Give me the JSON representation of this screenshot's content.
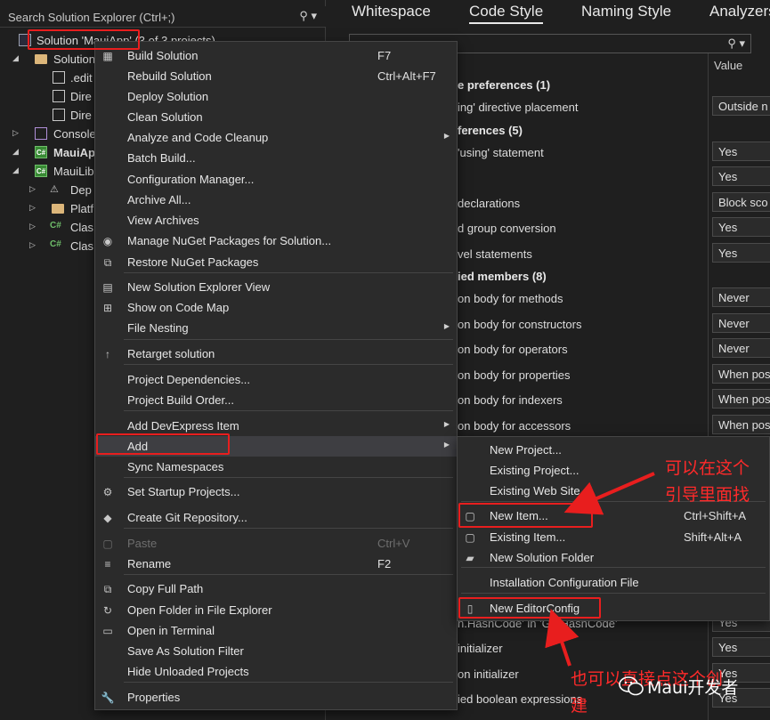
{
  "solution_explorer": {
    "search_placeholder": "Search Solution Explorer (Ctrl+;)",
    "tree": [
      {
        "label": "Solution 'MauiApp' (3 of 3 projects)",
        "icon": "solution-icon",
        "bold": false
      },
      {
        "label": "Solution",
        "icon": "folder-icon",
        "bold": false
      },
      {
        "label": ".edit",
        "icon": "file-icon",
        "bold": false
      },
      {
        "label": "Dire",
        "icon": "file-icon",
        "bold": false
      },
      {
        "label": "Dire",
        "icon": "file-icon",
        "bold": false
      },
      {
        "label": "Console",
        "icon": "console-project-icon",
        "bold": false
      },
      {
        "label": "MauiAp",
        "icon": "csharp-project-icon",
        "bold": true
      },
      {
        "label": "MauiLib",
        "icon": "csharp-project-icon",
        "bold": false
      },
      {
        "label": "Dep",
        "icon": "dependencies-icon",
        "bold": false
      },
      {
        "label": "Platf",
        "icon": "folder-icon",
        "bold": false
      },
      {
        "label": "Clas",
        "icon": "csharp-file-icon",
        "bold": false
      },
      {
        "label": "Clas",
        "icon": "csharp-file-icon",
        "bold": false
      }
    ]
  },
  "editor": {
    "tabs": [
      "Whitespace",
      "Code Style",
      "Naming Style",
      "Analyzers"
    ],
    "active_tab": "Code Style",
    "value_header": "Value",
    "rows": [
      {
        "label": "e preferences (1)",
        "section": true,
        "value": ""
      },
      {
        "label": "ing' directive placement",
        "section": false,
        "value": "Outside n"
      },
      {
        "label": "ferences (5)",
        "section": true,
        "value": ""
      },
      {
        "label": "'using' statement",
        "section": false,
        "value": "Yes"
      },
      {
        "label": "",
        "section": false,
        "value": "Yes"
      },
      {
        "label": "declarations",
        "section": false,
        "value": "Block sco"
      },
      {
        "label": "d group conversion",
        "section": false,
        "value": "Yes"
      },
      {
        "label": "vel statements",
        "section": false,
        "value": "Yes"
      },
      {
        "label": "ied members (8)",
        "section": true,
        "value": ""
      },
      {
        "label": "on body for methods",
        "section": false,
        "value": "Never"
      },
      {
        "label": "on body for constructors",
        "section": false,
        "value": "Never"
      },
      {
        "label": "on body for operators",
        "section": false,
        "value": "Never"
      },
      {
        "label": "on body for properties",
        "section": false,
        "value": "When pos"
      },
      {
        "label": "on body for indexers",
        "section": false,
        "value": "When pos"
      },
      {
        "label": "on body for accessors",
        "section": false,
        "value": "When pos"
      },
      {
        "label": "n.HashCode' in 'GetHashCode'",
        "section": false,
        "value": "Yes"
      },
      {
        "label": "initializer",
        "section": false,
        "value": "Yes"
      },
      {
        "label": "on initializer",
        "section": false,
        "value": "Yes"
      },
      {
        "label": "ied boolean expressions",
        "section": false,
        "value": "Yes"
      }
    ]
  },
  "context_menu": {
    "items": [
      {
        "label": "Build Solution",
        "shortcut": "F7",
        "icon": "build-icon",
        "submenu": false,
        "disabled": false
      },
      {
        "label": "Rebuild Solution",
        "shortcut": "Ctrl+Alt+F7",
        "icon": "",
        "submenu": false,
        "disabled": false
      },
      {
        "label": "Deploy Solution",
        "shortcut": "",
        "icon": "",
        "submenu": false,
        "disabled": false
      },
      {
        "label": "Clean Solution",
        "shortcut": "",
        "icon": "",
        "submenu": false,
        "disabled": false
      },
      {
        "label": "Analyze and Code Cleanup",
        "shortcut": "",
        "icon": "",
        "submenu": true,
        "disabled": false
      },
      {
        "label": "Batch Build...",
        "shortcut": "",
        "icon": "",
        "submenu": false,
        "disabled": false
      },
      {
        "label": "Configuration Manager...",
        "shortcut": "",
        "icon": "",
        "submenu": false,
        "disabled": false
      },
      {
        "label": "Archive All...",
        "shortcut": "",
        "icon": "",
        "submenu": false,
        "disabled": false
      },
      {
        "label": "View Archives",
        "shortcut": "",
        "icon": "",
        "submenu": false,
        "disabled": false
      },
      {
        "label": "Manage NuGet Packages for Solution...",
        "shortcut": "",
        "icon": "nuget-icon",
        "submenu": false,
        "disabled": false
      },
      {
        "label": "Restore NuGet Packages",
        "shortcut": "",
        "icon": "restore-icon",
        "submenu": false,
        "disabled": false
      },
      {
        "label": "New Solution Explorer View",
        "shortcut": "",
        "icon": "new-view-icon",
        "submenu": false,
        "disabled": false
      },
      {
        "label": "Show on Code Map",
        "shortcut": "",
        "icon": "code-map-icon",
        "submenu": false,
        "disabled": false
      },
      {
        "label": "File Nesting",
        "shortcut": "",
        "icon": "",
        "submenu": true,
        "disabled": false
      },
      {
        "label": "Retarget solution",
        "shortcut": "",
        "icon": "retarget-icon",
        "submenu": false,
        "disabled": false
      },
      {
        "label": "Project Dependencies...",
        "shortcut": "",
        "icon": "",
        "submenu": false,
        "disabled": false
      },
      {
        "label": "Project Build Order...",
        "shortcut": "",
        "icon": "",
        "submenu": false,
        "disabled": false
      },
      {
        "label": "Add DevExpress Item",
        "shortcut": "",
        "icon": "",
        "submenu": true,
        "disabled": false
      },
      {
        "label": "Add",
        "shortcut": "",
        "icon": "",
        "submenu": true,
        "disabled": false
      },
      {
        "label": "Sync Namespaces",
        "shortcut": "",
        "icon": "",
        "submenu": false,
        "disabled": false
      },
      {
        "label": "Set Startup Projects...",
        "shortcut": "",
        "icon": "gear-icon",
        "submenu": false,
        "disabled": false
      },
      {
        "label": "Create Git Repository...",
        "shortcut": "",
        "icon": "git-icon",
        "submenu": false,
        "disabled": false
      },
      {
        "label": "Paste",
        "shortcut": "Ctrl+V",
        "icon": "paste-icon",
        "submenu": false,
        "disabled": true
      },
      {
        "label": "Rename",
        "shortcut": "F2",
        "icon": "rename-icon",
        "submenu": false,
        "disabled": false
      },
      {
        "label": "Copy Full Path",
        "shortcut": "",
        "icon": "copy-icon",
        "submenu": false,
        "disabled": false
      },
      {
        "label": "Open Folder in File Explorer",
        "shortcut": "",
        "icon": "open-folder-icon",
        "submenu": false,
        "disabled": false
      },
      {
        "label": "Open in Terminal",
        "shortcut": "",
        "icon": "terminal-icon",
        "submenu": false,
        "disabled": false
      },
      {
        "label": "Save As Solution Filter",
        "shortcut": "",
        "icon": "",
        "submenu": false,
        "disabled": false
      },
      {
        "label": "Hide Unloaded Projects",
        "shortcut": "",
        "icon": "",
        "submenu": false,
        "disabled": false
      },
      {
        "label": "Properties",
        "shortcut": "",
        "icon": "wrench-icon",
        "submenu": false,
        "disabled": false
      }
    ]
  },
  "add_submenu": {
    "items": [
      {
        "label": "New Project...",
        "shortcut": "",
        "icon": ""
      },
      {
        "label": "Existing Project...",
        "shortcut": "",
        "icon": ""
      },
      {
        "label": "Existing Web Site...",
        "shortcut": "",
        "icon": ""
      },
      {
        "label": "New Item...",
        "shortcut": "Ctrl+Shift+A",
        "icon": "new-item-icon"
      },
      {
        "label": "Existing Item...",
        "shortcut": "Shift+Alt+A",
        "icon": "existing-item-icon"
      },
      {
        "label": "New Solution Folder",
        "shortcut": "",
        "icon": "new-folder-icon"
      },
      {
        "label": "Installation Configuration File",
        "shortcut": "",
        "icon": ""
      },
      {
        "label": "New EditorConfig",
        "shortcut": "",
        "icon": "editorconfig-icon"
      }
    ]
  },
  "annotations": {
    "callout_1_line1": "可以在这个",
    "callout_1_line2": "引导里面找",
    "callout_2_line1": "也可以直接点这个创",
    "callout_2_line2": "建",
    "watermark": "Maui开发者",
    "accent_color": "#e81e1e"
  }
}
